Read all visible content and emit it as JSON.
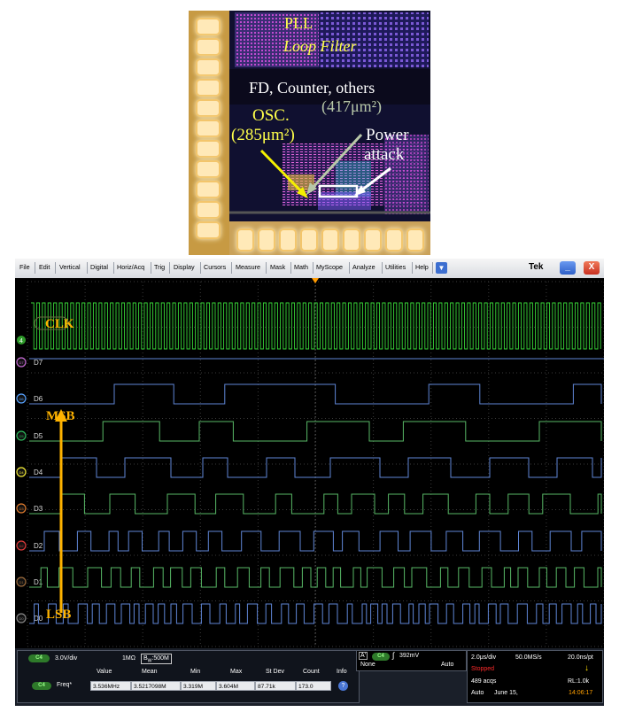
{
  "chip": {
    "labels": {
      "pll": "PLL",
      "loop_filter": "Loop Filter",
      "fd_counter": "FD, Counter, others",
      "area_counter": "(417μm²)",
      "osc": "OSC.",
      "area_osc": "(285μm²)",
      "power_attack_line1": "Power",
      "power_attack_line2": "attack"
    }
  },
  "scope": {
    "menu": [
      "File",
      "Edit",
      "Vertical",
      "Digital",
      "Horiz/Acq",
      "Trig",
      "Display",
      "Cursors",
      "Measure",
      "Mask",
      "Math",
      "MyScope",
      "Analyze",
      "Utilities",
      "Help"
    ],
    "brand": "Tek",
    "window_buttons": {
      "minimize": "_",
      "close": "X"
    },
    "annotations": {
      "clk": "CLK",
      "msb": "MSB",
      "lsb": "LSB"
    },
    "channels": [
      {
        "id": "D7",
        "label": "D7",
        "color": "#c56ad4"
      },
      {
        "id": "D6",
        "label": "D6",
        "color": "#57a2ff"
      },
      {
        "id": "D5",
        "label": "D5",
        "color": "#2db85c"
      },
      {
        "id": "D4",
        "label": "D4",
        "color": "#f4ec38"
      },
      {
        "id": "D3",
        "label": "D3",
        "color": "#e07b2d"
      },
      {
        "id": "D2",
        "label": "D2",
        "color": "#e03a3a"
      },
      {
        "id": "D1",
        "label": "D1",
        "color": "#9c6b3c"
      },
      {
        "id": "D0",
        "label": "D0",
        "color": "#888888"
      }
    ],
    "analog_marker": "4",
    "status": {
      "ch_badge": "C4",
      "vdiv": "3.0V/div",
      "impedance": "1MΩ",
      "bw_prefix": "B",
      "bw_sub": "W",
      "bandwidth": ":500M",
      "measure_headers": [
        "Value",
        "Mean",
        "Min",
        "Max",
        "St Dev",
        "Count",
        "Info"
      ],
      "measure_source": "C4",
      "measure_name": "Freq*",
      "measure_values": [
        "3.536MHz",
        "3.5217098M",
        "3.319M",
        "3.604M",
        "87.71k",
        "173.0"
      ],
      "trigger_label": "A'",
      "trigger_source": "C4",
      "trigger_level": "392mV",
      "trigger_coupling": "None",
      "trigger_mode": "Auto",
      "timebase": "2.0μs/div",
      "sample_rate": "50.0MS/s",
      "resolution": "20.0ns/pt",
      "run_state": "Stopped",
      "acqs": "489 acqs",
      "record_length": "RL:1.0k",
      "acq_mode": "Auto",
      "date": "June 15,",
      "time": "14:06:17"
    },
    "colors": {
      "clock": "#38d838",
      "digital_trace": "#5f86d6",
      "digital_high": "#58b866",
      "annotation": "#ffb300",
      "trigger_marker": "#ff9a00",
      "stopped": "#ff2a2a",
      "time": "#ffa000"
    }
  }
}
